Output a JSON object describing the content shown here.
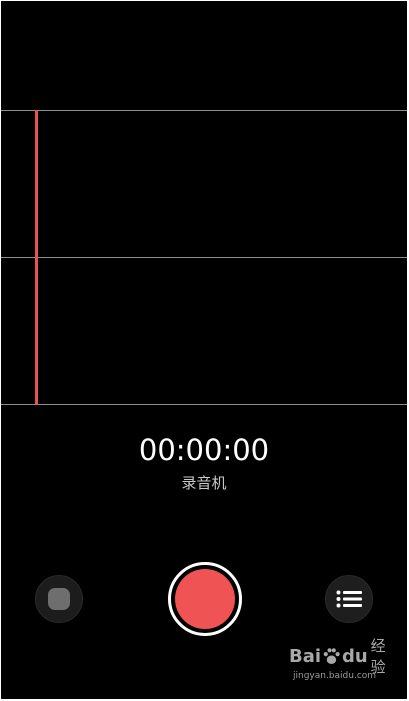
{
  "timer": {
    "value": "00:00:00"
  },
  "app": {
    "label": "录音机"
  },
  "controls": {
    "stop_icon": "stop-square-icon",
    "record_icon": "record-dot-icon",
    "list_icon": "list-icon",
    "record_color": "#f05353",
    "playhead_color": "#e55451"
  },
  "watermark": {
    "brand_left": "Bai",
    "brand_right": "du",
    "product": "经验",
    "url": "jingyan.baidu.com"
  }
}
